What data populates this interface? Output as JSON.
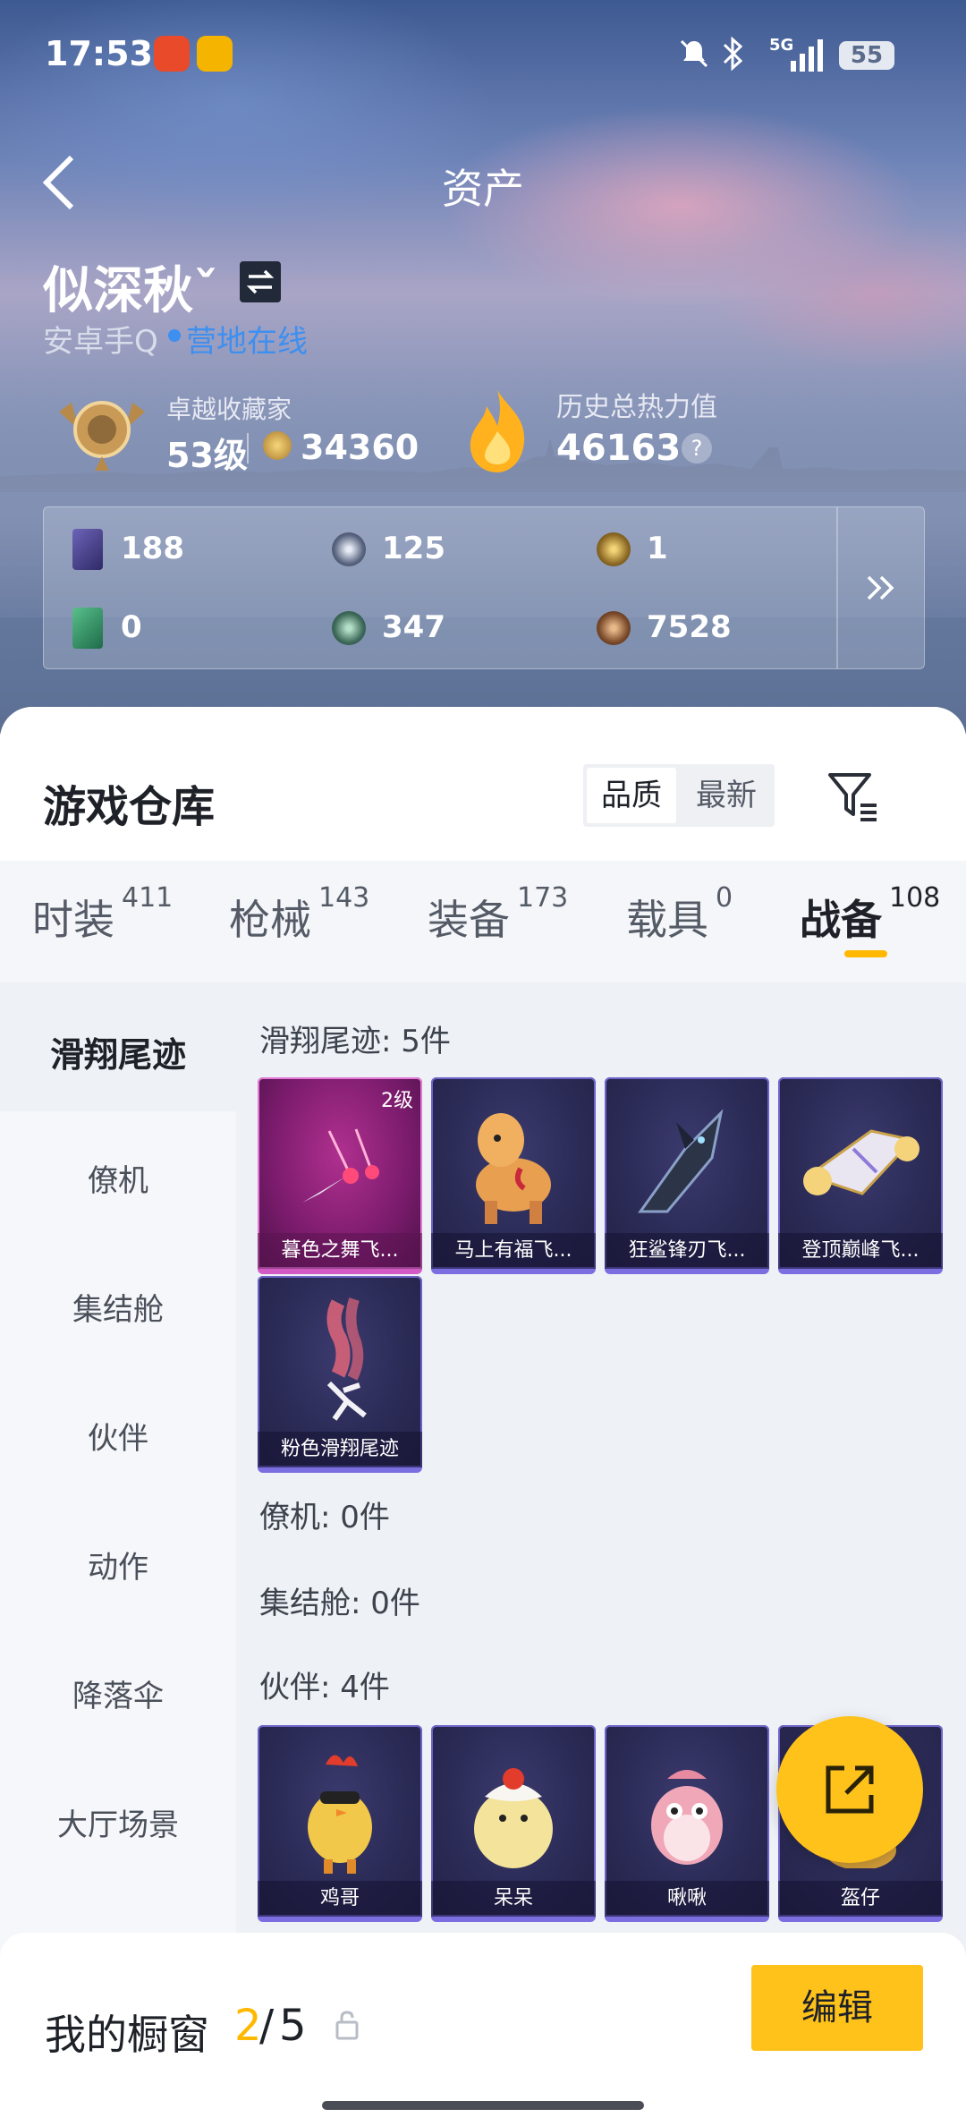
{
  "status_bar": {
    "time": "17:53",
    "signal_label": "5G",
    "battery": "55"
  },
  "header": {
    "title": "资产"
  },
  "profile": {
    "name": "似深秋ˇ",
    "platform": "安卓手Q",
    "status": "营地在线",
    "rank_title": "卓越收藏家",
    "level": "53级",
    "points": "34360",
    "heat_label": "历史总热力值",
    "heat_value": "46163",
    "help": "?"
  },
  "stats": [
    {
      "icon": "purple-card-icon",
      "value": "188"
    },
    {
      "icon": "silver-coin-icon",
      "value": "125"
    },
    {
      "icon": "gold-coin-icon",
      "value": "1"
    },
    {
      "icon": "green-ticket-icon",
      "value": "0"
    },
    {
      "icon": "teal-coin-icon",
      "value": "347"
    },
    {
      "icon": "bronze-coin-icon",
      "value": "7528"
    }
  ],
  "warehouse": {
    "title": "游戏仓库",
    "sort_quality": "品质",
    "sort_latest": "最新"
  },
  "tabs": [
    {
      "label": "时装",
      "count": "411"
    },
    {
      "label": "枪械",
      "count": "143"
    },
    {
      "label": "装备",
      "count": "173"
    },
    {
      "label": "载具",
      "count": "0"
    },
    {
      "label": "战备",
      "count": "108",
      "active": true
    }
  ],
  "sidebar": [
    "滑翔尾迹",
    "僚机",
    "集结舱",
    "伙伴",
    "动作",
    "降落伞",
    "大厅场景"
  ],
  "sections": {
    "trail_title": "滑翔尾迹: 5件",
    "wingman_title": "僚机: 0件",
    "pod_title": "集结舱: 0件",
    "partner_title": "伙伴: 4件"
  },
  "trail_items": [
    {
      "name": "暮色之舞飞...",
      "badge": "2级"
    },
    {
      "name": "马上有福飞..."
    },
    {
      "name": "狂鲨锋刃飞..."
    },
    {
      "name": "登顶巅峰飞..."
    },
    {
      "name": "粉色滑翔尾迹"
    }
  ],
  "partner_items": [
    {
      "name": "鸡哥"
    },
    {
      "name": "呆呆"
    },
    {
      "name": "啾啾"
    },
    {
      "name": "盔仔"
    }
  ],
  "footer": {
    "label": "我的橱窗",
    "current": "2",
    "sep": "/",
    "total": "5",
    "edit": "编辑"
  },
  "colors": {
    "accent": "#ffc21a",
    "link": "#3d8ff0",
    "active_underline": "#ffb800"
  }
}
